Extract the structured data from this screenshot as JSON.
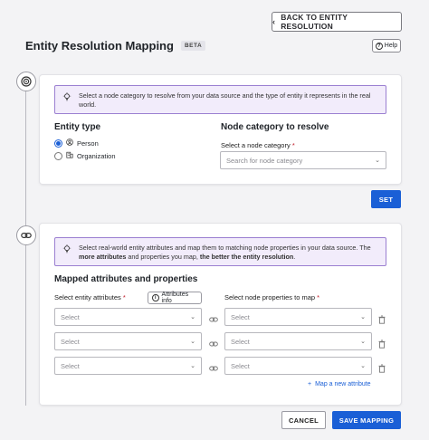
{
  "header": {
    "back_label": "BACK TO ENTITY RESOLUTION",
    "title": "Entity Resolution Mapping",
    "beta_badge": "BETA",
    "help_label": "Help"
  },
  "step1": {
    "info_text": "Select a node category to resolve from your data source and the type of entity it represents in the real world.",
    "entity_type_heading": "Entity type",
    "entity_options": [
      {
        "label": "Person",
        "selected": true,
        "icon": "person-icon"
      },
      {
        "label": "Organization",
        "selected": false,
        "icon": "building-icon"
      }
    ],
    "node_category_heading": "Node category to resolve",
    "node_category_label": "Select a node category",
    "required_mark": "*",
    "node_category_placeholder": "Search for node category",
    "set_label": "SET"
  },
  "step2": {
    "info_prefix": "Select real-world entity attributes and map them to matching node properties in your data source. The ",
    "info_bold1": "more attributes",
    "info_mid": " and properties you map, ",
    "info_bold2": "the better the entity resolution",
    "info_suffix": ".",
    "heading": "Mapped attributes and properties",
    "entity_attr_label": "Select entity attributes",
    "required_mark": "*",
    "attributes_info_label": "Attributes info",
    "node_props_label": "Select node properties to map",
    "rows": [
      {
        "attr_placeholder": "Select",
        "prop_placeholder": "Select"
      },
      {
        "attr_placeholder": "Select",
        "prop_placeholder": "Select"
      },
      {
        "attr_placeholder": "Select",
        "prop_placeholder": "Select"
      }
    ],
    "map_new_label": "Map a new attribute"
  },
  "footer": {
    "cancel_label": "CANCEL",
    "save_label": "SAVE MAPPING"
  },
  "colors": {
    "primary": "#1a5fd6",
    "info_border": "#9b7fd1",
    "info_bg": "#f2ecfb"
  }
}
